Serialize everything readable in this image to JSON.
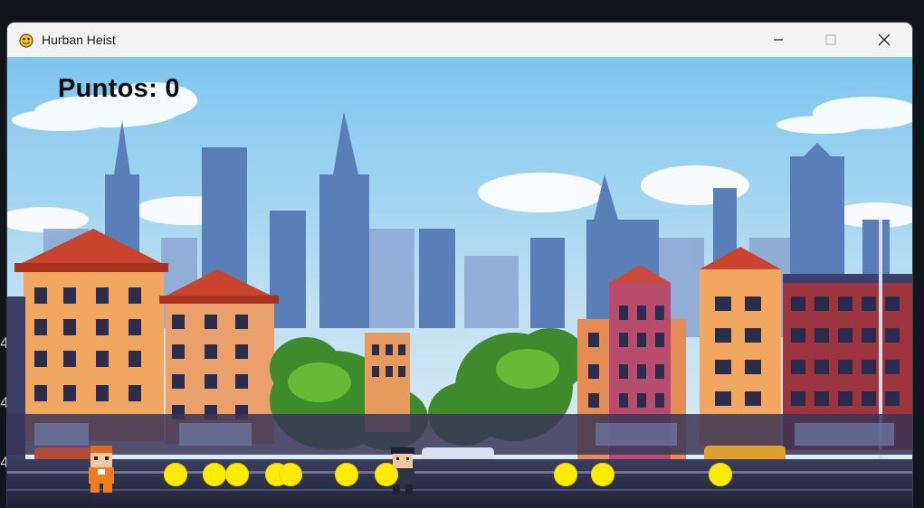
{
  "window": {
    "title": "Hurban Heist",
    "icon": "pygame-snake-icon",
    "controls": [
      "minimize-icon",
      "maximize-icon",
      "close-icon"
    ]
  },
  "background_fragments": [
    "4",
    "4",
    "4"
  ],
  "hud": {
    "score_label": "Puntos: 0",
    "score": 0
  },
  "scene": {
    "description_tags": [
      "pixel-art city skyline",
      "street"
    ],
    "player": "orange-jumpsuit-thief",
    "enemy": "police-officer",
    "coin_color": "#ffeb00",
    "coin_count": 11
  },
  "colors": {
    "sky_top": "#7ec6ee",
    "sky_bottom": "#cfe6f4",
    "road": "#2c2f4a",
    "coin": "#ffeb00"
  }
}
